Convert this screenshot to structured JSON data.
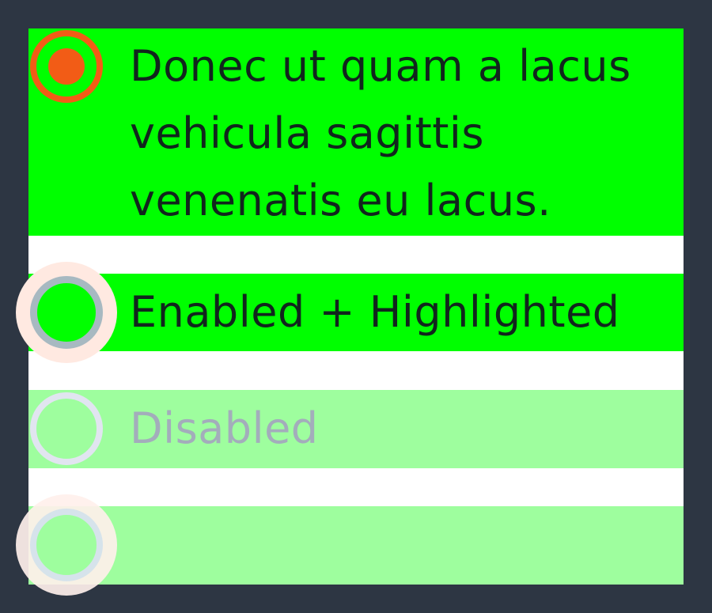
{
  "radio_group": {
    "options": [
      {
        "label": "Donec ut quam a lacus vehicula sagittis venenatis eu lacus.",
        "state": "selected"
      },
      {
        "label": "Enabled + Highlighted",
        "state": "highlighted"
      },
      {
        "label": "Disabled",
        "state": "disabled"
      },
      {
        "label": "",
        "state": "disabled-highlighted"
      }
    ]
  },
  "colors": {
    "page_background": "#2d3643",
    "panel_background": "#ffffff",
    "option_background": "#00ff00",
    "option_background_disabled": "#9efe9e",
    "selected_accent": "#f25c16",
    "label_text": "#11261d",
    "label_text_disabled": "#a3adbb",
    "highlight_halo": "#ffe9e1"
  }
}
